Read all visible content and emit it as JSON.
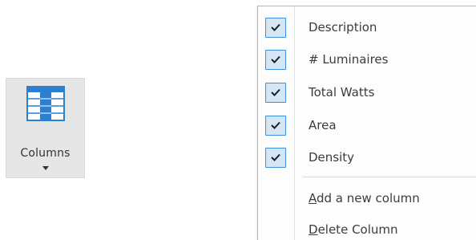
{
  "ribbon": {
    "columns_label": "Columns"
  },
  "menu": {
    "items": [
      {
        "label": "Description",
        "checked": true
      },
      {
        "label": "# Luminaires",
        "checked": true
      },
      {
        "label": "Total Watts",
        "checked": true
      },
      {
        "label": "Area",
        "checked": true
      },
      {
        "label": "Density",
        "checked": true
      }
    ],
    "add_column": {
      "accel": "A",
      "rest": "dd a new column"
    },
    "delete_column": {
      "accel": "D",
      "rest": "elete Column"
    }
  },
  "colors": {
    "check_border": "#3f8fd6",
    "check_fill": "#d5e6f6",
    "icon_blue": "#2b7fd0"
  }
}
